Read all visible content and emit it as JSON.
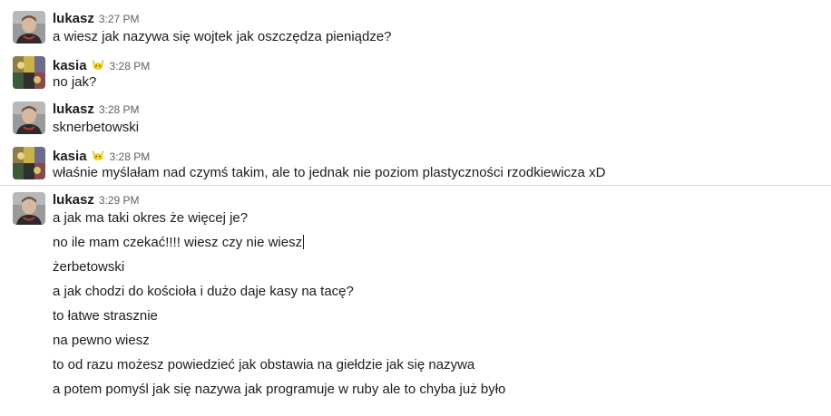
{
  "messages": [
    {
      "author": "lukasz",
      "time": "3:27 PM",
      "avatar": "lukasz-avatar",
      "text": "a wiesz jak nazywa się wojtek jak oszczędza pieniądze?"
    },
    {
      "author": "kasia",
      "time": "3:28 PM",
      "avatar": "kasia-avatar",
      "badge": "pikachu-icon",
      "text": "no jak?"
    },
    {
      "author": "lukasz",
      "time": "3:28 PM",
      "avatar": "lukasz-avatar",
      "text": "sknerbetowski"
    },
    {
      "author": "kasia",
      "time": "3:28 PM",
      "avatar": "kasia-avatar",
      "badge": "pikachu-icon",
      "text": "właśnie myślałam nad czymś takim, ale to jednak nie poziom plastyczności rzodkiewicza xD"
    },
    {
      "author": "lukasz",
      "time": "3:29 PM",
      "avatar": "lukasz-avatar",
      "text": "a jak ma taki okres że więcej je?"
    }
  ],
  "continuations": [
    "no ile mam czekać!!!! wiesz czy nie wiesz",
    "żerbetowski",
    "a jak chodzi do kościoła i dużo daje kasy na tacę?",
    "to łatwe strasznie",
    "na pewno wiesz",
    "to od razu możesz powiedzieć jak obstawia na giełdzie jak się nazywa",
    "a potem pomyśl jak się nazywa jak programuje w ruby ale to chyba już było"
  ],
  "colors": {
    "text": "#1d1c1d",
    "timestamp": "#616061",
    "new_messages_divider": "#e8c6d4"
  }
}
